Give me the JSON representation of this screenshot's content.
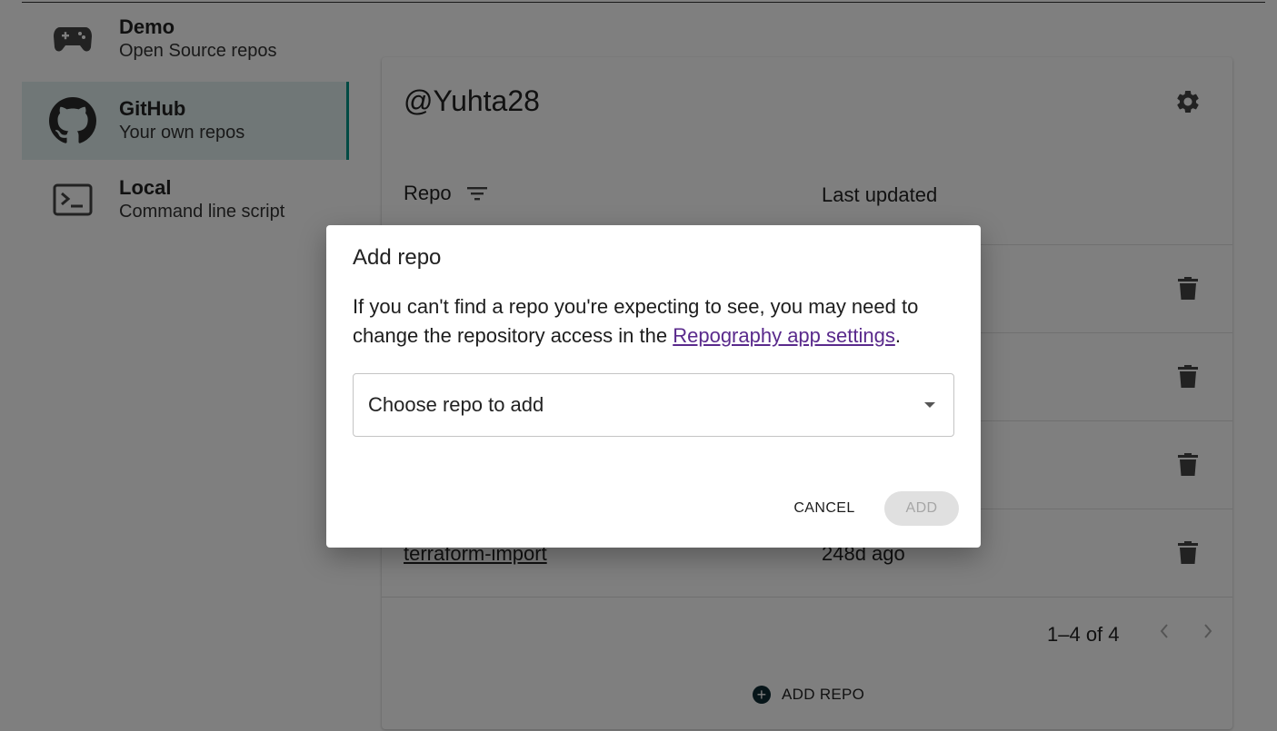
{
  "sidebar": {
    "items": [
      {
        "title": "Demo",
        "subtitle": "Open Source repos",
        "icon": "gamepad-icon"
      },
      {
        "title": "GitHub",
        "subtitle": "Your own repos",
        "icon": "github-icon"
      },
      {
        "title": "Local",
        "subtitle": "Command line script",
        "icon": "terminal-icon"
      }
    ]
  },
  "main": {
    "title": "@Yuhta28",
    "table": {
      "headers": {
        "repo": "Repo",
        "updated": "Last updated"
      },
      "rows": [
        {
          "name": "terraform-import",
          "updated": "248d ago"
        }
      ]
    },
    "pagination": {
      "text": "1–4 of 4"
    },
    "add_repo_label": "ADD REPO"
  },
  "dialog": {
    "title": "Add repo",
    "body_text": "If you can't find a repo you're expecting to see, you may need to change the repository access in the ",
    "link_text": "Repography app settings",
    "body_end": ".",
    "select_placeholder": "Choose repo to add",
    "cancel_label": "CANCEL",
    "add_label": "ADD"
  },
  "colors": {
    "accent": "#009688",
    "link": "#5a2a8c",
    "backdrop": "rgba(0,0,0,0.5)"
  }
}
